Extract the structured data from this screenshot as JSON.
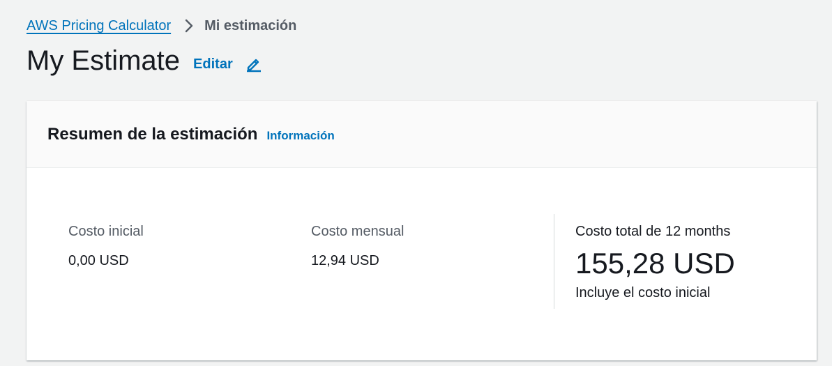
{
  "breadcrumb": {
    "root_label": "AWS Pricing Calculator",
    "current_label": "Mi estimación"
  },
  "header": {
    "title": "My Estimate",
    "edit_label": "Editar"
  },
  "summary": {
    "title": "Resumen de la estimación",
    "info_label": "Información",
    "upfront": {
      "label": "Costo inicial",
      "value": "0,00 USD"
    },
    "monthly": {
      "label": "Costo mensual",
      "value": "12,94 USD"
    },
    "total": {
      "label": "Costo total de 12 months",
      "value": "155,28 USD",
      "note": "Incluye el costo inicial"
    }
  },
  "colors": {
    "link": "#0073bb",
    "background": "#f2f3f3",
    "text": "#16191f",
    "secondary_text": "#545b64"
  },
  "icons": {
    "separator": "chevron-right-icon",
    "edit": "pencil-icon"
  }
}
